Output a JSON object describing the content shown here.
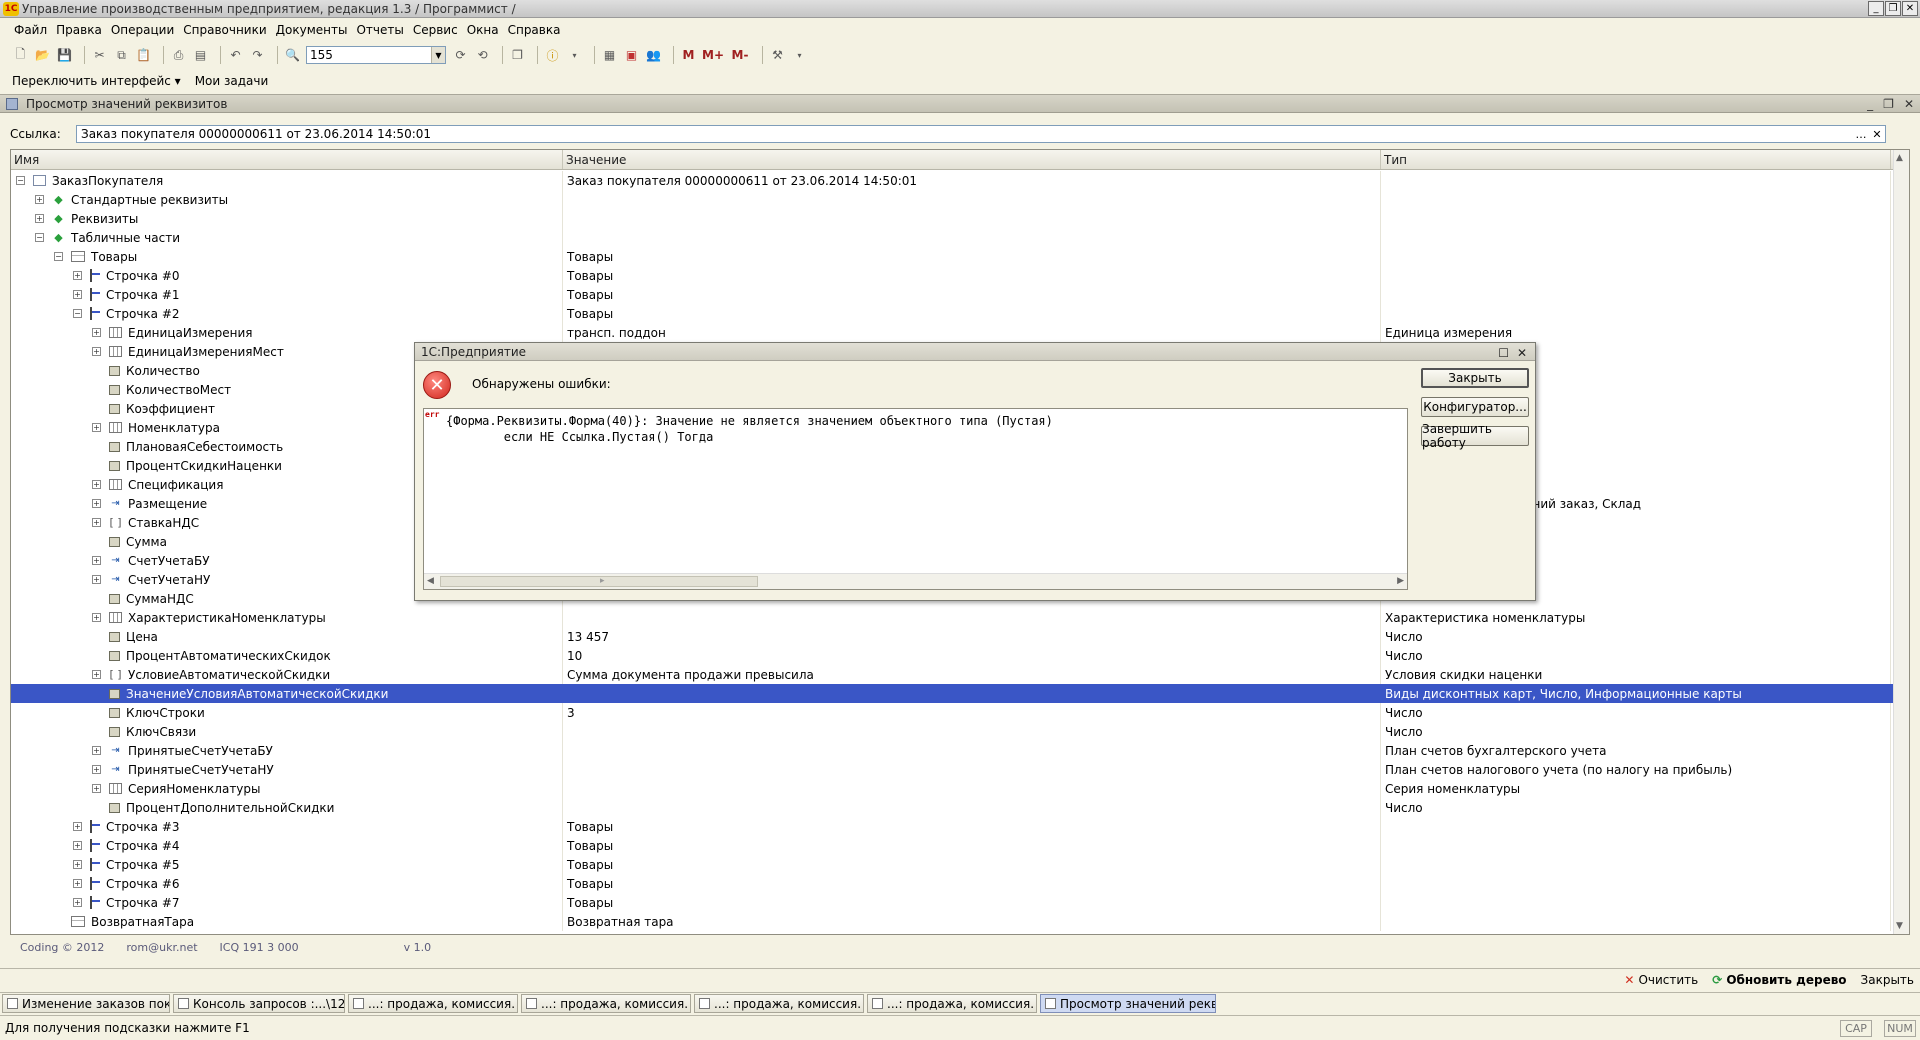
{
  "window": {
    "title": "Управление производственным предприятием, редакция 1.3 / Программист /",
    "logo_text": "1С"
  },
  "menu": [
    "Файл",
    "Правка",
    "Операции",
    "Справочники",
    "Документы",
    "Отчеты",
    "Сервис",
    "Окна",
    "Справка"
  ],
  "toolbar": {
    "search_value": "155",
    "m_label": "M",
    "mplus_label": "M+",
    "mminus_label": "M-"
  },
  "toolbar2": {
    "switch_interface": "Переключить интерфейс ▾",
    "my_tasks": "Мои задачи"
  },
  "panel": {
    "title": "Просмотр значений реквизитов",
    "link_label": "Ссылка:",
    "link_value": "Заказ покупателя 00000000611 от 23.06.2014 14:50:01",
    "columns": [
      "Имя",
      "Значение",
      "Тип"
    ],
    "rows": [
      {
        "name": "ЗаказПокупателя",
        "value": "Заказ покупателя 00000000611 от 23.06.2014 14:50:01",
        "type": "",
        "level": 0,
        "exp": "-",
        "icon": "doc"
      },
      {
        "name": "Стандартные реквизиты",
        "value": "",
        "type": "",
        "level": 1,
        "exp": "+",
        "icon": "green"
      },
      {
        "name": "Реквизиты",
        "value": "",
        "type": "",
        "level": 1,
        "exp": "+",
        "icon": "green"
      },
      {
        "name": "Табличные части",
        "value": "",
        "type": "",
        "level": 1,
        "exp": "-",
        "icon": "green"
      },
      {
        "name": "Товары",
        "value": "Товары",
        "type": "",
        "level": 2,
        "exp": "-",
        "icon": "table"
      },
      {
        "name": "Строчка #0",
        "value": "Товары",
        "type": "",
        "level": 3,
        "exp": "+",
        "icon": "line"
      },
      {
        "name": "Строчка #1",
        "value": "Товары",
        "type": "",
        "level": 3,
        "exp": "+",
        "icon": "line"
      },
      {
        "name": "Строчка #2",
        "value": "Товары",
        "type": "",
        "level": 3,
        "exp": "-",
        "icon": "line"
      },
      {
        "name": "ЕдиницаИзмерения",
        "value": "трансп. поддон",
        "type": "Единица измерения",
        "level": 4,
        "exp": "+",
        "icon": "grid3"
      },
      {
        "name": "ЕдиницаИзмеренияМест",
        "value": "",
        "type": "",
        "level": 4,
        "exp": "+",
        "icon": "grid3"
      },
      {
        "name": "Количество",
        "value": "",
        "type": "",
        "level": 4,
        "exp": "",
        "icon": "attr"
      },
      {
        "name": "КоличествоМест",
        "value": "",
        "type": "",
        "level": 4,
        "exp": "",
        "icon": "attr"
      },
      {
        "name": "Коэффициент",
        "value": "",
        "type": "",
        "level": 4,
        "exp": "",
        "icon": "attr"
      },
      {
        "name": "Номенклатура",
        "value": "",
        "type": "",
        "level": 4,
        "exp": "+",
        "icon": "grid3"
      },
      {
        "name": "ПлановаяСебестоимость",
        "value": "",
        "type": "",
        "level": 4,
        "exp": "",
        "icon": "attr"
      },
      {
        "name": "ПроцентСкидкиНаценки",
        "value": "",
        "type": "",
        "level": 4,
        "exp": "",
        "icon": "attr"
      },
      {
        "name": "Спецификация",
        "value": "",
        "type": "",
        "level": 4,
        "exp": "+",
        "icon": "grid3"
      },
      {
        "name": "Размещение",
        "value": "",
        "type": "з поставщику, Внутренний заказ, Склад",
        "level": 4,
        "exp": "+",
        "icon": "ref"
      },
      {
        "name": "СтавкаНДС",
        "value": "",
        "type": "",
        "level": 4,
        "exp": "+",
        "icon": "brk"
      },
      {
        "name": "Сумма",
        "value": "",
        "type": "",
        "level": 4,
        "exp": "",
        "icon": "attr"
      },
      {
        "name": "СчетУчетаБУ",
        "value": "",
        "type": "чета",
        "level": 4,
        "exp": "+",
        "icon": "ref"
      },
      {
        "name": "СчетУчетаНУ",
        "value": "",
        "type": "(по налогу на прибыль)",
        "level": 4,
        "exp": "+",
        "icon": "ref"
      },
      {
        "name": "СуммаНДС",
        "value": "",
        "type": "",
        "level": 4,
        "exp": "",
        "icon": "attr"
      },
      {
        "name": "ХарактеристикаНоменклатуры",
        "value": "",
        "type": "Характеристика номенклатуры",
        "level": 4,
        "exp": "+",
        "icon": "grid3"
      },
      {
        "name": "Цена",
        "value": "13 457",
        "type": "Число",
        "level": 4,
        "exp": "",
        "icon": "attr"
      },
      {
        "name": "ПроцентАвтоматическихСкидок",
        "value": "10",
        "type": "Число",
        "level": 4,
        "exp": "",
        "icon": "attr"
      },
      {
        "name": "УсловиеАвтоматическойСкидки",
        "value": "Сумма документа продажи превысила",
        "type": "Условия скидки наценки",
        "level": 4,
        "exp": "+",
        "icon": "brk"
      },
      {
        "name": "ЗначениеУсловияАвтоматическойСкидки",
        "value": "",
        "type": "Виды дисконтных карт, Число, Информационные карты",
        "level": 4,
        "exp": "",
        "icon": "attr",
        "selected": true
      },
      {
        "name": "КлючСтроки",
        "value": "3",
        "type": "Число",
        "level": 4,
        "exp": "",
        "icon": "attr"
      },
      {
        "name": "КлючСвязи",
        "value": "",
        "type": "Число",
        "level": 4,
        "exp": "",
        "icon": "attr"
      },
      {
        "name": "ПринятыеСчетУчетаБУ",
        "value": "",
        "type": "План счетов бухгалтерского учета",
        "level": 4,
        "exp": "+",
        "icon": "ref"
      },
      {
        "name": "ПринятыеСчетУчетаНУ",
        "value": "",
        "type": "План счетов налогового учета (по налогу на прибыль)",
        "level": 4,
        "exp": "+",
        "icon": "ref"
      },
      {
        "name": "СерияНоменклатуры",
        "value": "",
        "type": "Серия номенклатуры",
        "level": 4,
        "exp": "+",
        "icon": "grid3"
      },
      {
        "name": "ПроцентДополнительнойСкидки",
        "value": "",
        "type": "Число",
        "level": 4,
        "exp": "",
        "icon": "attr"
      },
      {
        "name": "Строчка #3",
        "value": "Товары",
        "type": "",
        "level": 3,
        "exp": "+",
        "icon": "line"
      },
      {
        "name": "Строчка #4",
        "value": "Товары",
        "type": "",
        "level": 3,
        "exp": "+",
        "icon": "line"
      },
      {
        "name": "Строчка #5",
        "value": "Товары",
        "type": "",
        "level": 3,
        "exp": "+",
        "icon": "line"
      },
      {
        "name": "Строчка #6",
        "value": "Товары",
        "type": "",
        "level": 3,
        "exp": "+",
        "icon": "line"
      },
      {
        "name": "Строчка #7",
        "value": "Товары",
        "type": "",
        "level": 3,
        "exp": "+",
        "icon": "line"
      },
      {
        "name": "ВозвратнаяТара",
        "value": "Возвратная тара",
        "type": "",
        "level": 2,
        "exp": "",
        "icon": "table"
      }
    ],
    "footer": [
      "Coding © 2012",
      "rom@ukr.net",
      "ICQ 191 3 000",
      "v 1.0"
    ]
  },
  "actions": {
    "clear": "Очистить",
    "refresh": "Обновить дерево",
    "close": "Закрыть"
  },
  "tasks": [
    {
      "label": "Изменение заказов покупа...",
      "active": false
    },
    {
      "label": "Консоль запросов :...\\123.sel",
      "active": false
    },
    {
      "label": "...: продажа, комиссия. Про...",
      "active": false
    },
    {
      "label": "...: продажа, комиссия. Не ...",
      "active": false
    },
    {
      "label": "...: продажа, комиссия. Про...",
      "active": false
    },
    {
      "label": "...: продажа, комиссия. Нов...",
      "active": false
    },
    {
      "label": "Просмотр значений реквиз...",
      "active": true
    }
  ],
  "status": {
    "hint": "Для получения подсказки нажмите F1",
    "cap": "CAP",
    "num": "NUM"
  },
  "dialog": {
    "title": "1С:Предприятие",
    "heading": "Обнаружены ошибки:",
    "error_tag": "err",
    "error_text": "{Форма.Реквизиты.Форма(40)}: Значение не является значением объектного типа (Пустая)\n        если НЕ Ссылка.Пустая() Тогда",
    "buttons": [
      "Закрыть",
      "Конфигуратор...",
      "Завершить работу"
    ]
  }
}
